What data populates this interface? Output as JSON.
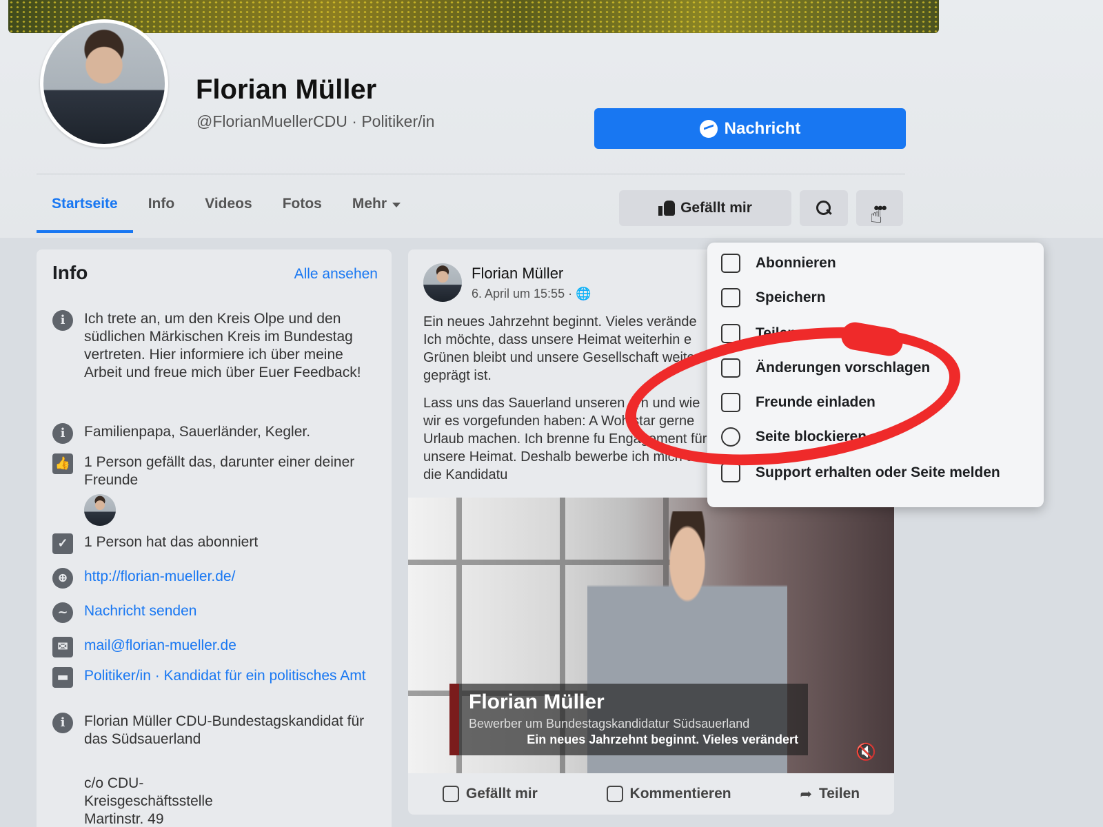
{
  "profile": {
    "name": "Florian Müller",
    "subtitle": "@FlorianMuellerCDU · Politiker/in",
    "message_button": "Nachricht"
  },
  "tabs": [
    "Startseite",
    "Info",
    "Videos",
    "Fotos",
    "Mehr"
  ],
  "actions": {
    "like": "Gefällt mir"
  },
  "info_card": {
    "title": "Info",
    "see_all": "Alle ansehen",
    "rows": {
      "bio": "Ich trete an, um den Kreis Olpe und den südlichen Märkischen Kreis im Bundestag vertreten. Hier informiere ich über meine Arbeit und freue mich über Euer Feedback!",
      "about": "Familienpapa, Sauerländer, Kegler.",
      "likes": "1 Person gefällt das, darunter einer deiner Freunde",
      "followers": "1 Person hat das abonniert",
      "website": "http://florian-mueller.de/",
      "message": "Nachricht senden",
      "email": "mail@florian-mueller.de",
      "category": "Politiker/in · Kandidat für ein politisches Amt",
      "address": "Florian Müller CDU-Bundestagskandidat für das Südsauerland",
      "address2": "c/o CDU-Kreisgeschäftsstelle Martinstr. 49"
    }
  },
  "post": {
    "author": "Florian Müller",
    "date": "6. April um 15:55 · ",
    "p1": "Ein neues Jahrzehnt beginnt. Vieles verände Ich möchte, dass unsere Heimat weiterhin e Grünen bleibt und unsere Gesellschaft weite geprägt ist.",
    "p2": "Lass uns das Sauerland unseren ern und wie wir es vorgefunden haben: A Wohlstar gerne Urlaub machen. Ich brenne fu Engagement für unsere Heimat. Deshalb bewerbe ich mich um die Kandidatu",
    "video": {
      "name": "Florian Müller",
      "subtitle": "Bewerber um Bundestagskandidatur  Südsauerland",
      "line": "Ein neues Jahrzehnt beginnt. Vieles verändert"
    },
    "actions": [
      "Gefällt mir",
      "Kommentieren",
      "Teilen"
    ]
  },
  "menu": {
    "items": [
      "Abonnieren",
      "Speichern",
      "Teilen",
      "Änderungen vorschlagen",
      "Freunde einladen",
      "Seite blockieren",
      "Support erhalten oder Seite melden"
    ]
  },
  "colors": {
    "accent": "#1877f2",
    "annotation": "#ef2a2a"
  }
}
